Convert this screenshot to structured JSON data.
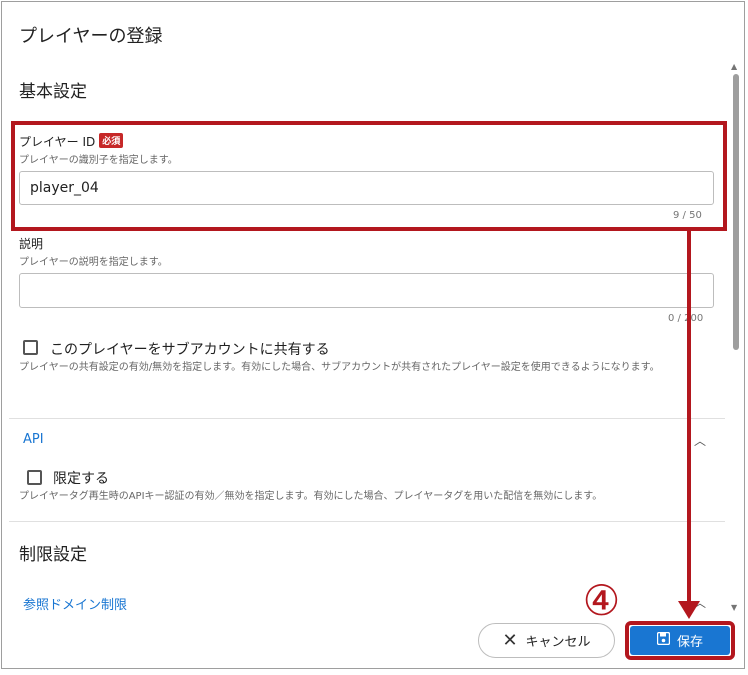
{
  "dialog": {
    "title": "プレイヤーの登録"
  },
  "basic_settings": {
    "title": "基本設定",
    "player_id": {
      "label": "プレイヤー ID",
      "required_badge": "必須",
      "help": "プレイヤーの識別子を指定します。",
      "value": "player_04",
      "counter": "9 / 50"
    },
    "description": {
      "label": "説明",
      "help": "プレイヤーの説明を指定します。",
      "value": "",
      "counter": "0 / 200"
    },
    "share": {
      "label": "このプレイヤーをサブアカウントに共有する",
      "help": "プレイヤーの共有設定の有効/無効を指定します。有効にした場合、サブアカウントが共有されたプレイヤー設定を使用できるようになります。",
      "checked": false
    }
  },
  "api_section": {
    "title": "API",
    "restrict": {
      "label": "限定する",
      "help": "プレイヤータグ再生時のAPIキー認証の有効／無効を指定します。有効にした場合、プレイヤータグを用いた配信を無効にします。",
      "checked": false
    }
  },
  "restrictions": {
    "title": "制限設定",
    "referrer_link": "参照ドメイン制限"
  },
  "footer": {
    "cancel_label": "キャンセル",
    "save_label": "保存"
  },
  "annotation": {
    "step": "④",
    "color": "#b3171e"
  },
  "colors": {
    "accent": "#1976d2",
    "highlight": "#b3171e",
    "required": "#c62828"
  },
  "icons": {
    "cancel": "close-icon",
    "save": "floppy-disk-icon",
    "collapse": "chevron-up-icon"
  }
}
